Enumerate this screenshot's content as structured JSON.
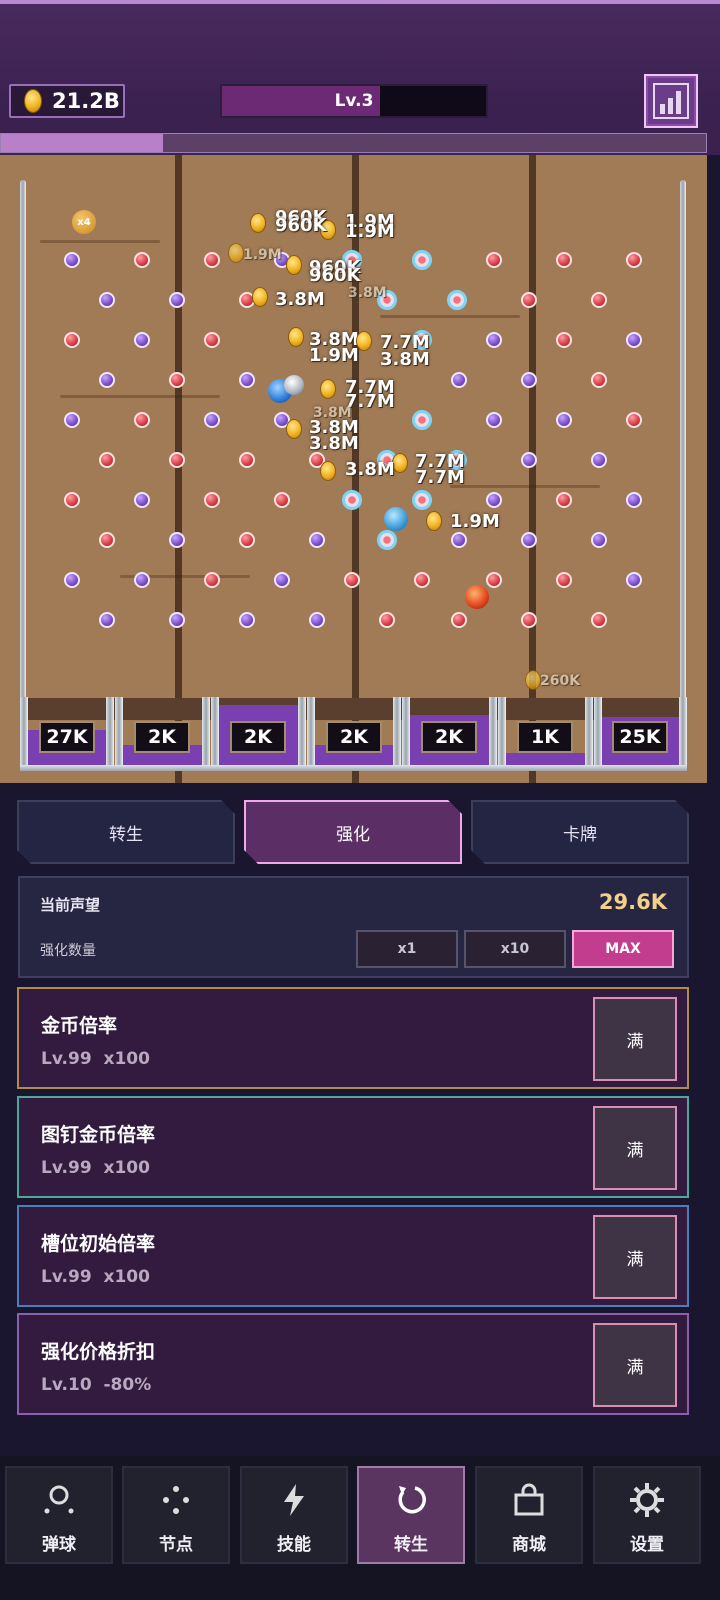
{
  "header": {
    "coin_balance": "21.2B",
    "level_label": "Lv.3",
    "level_progress": 0.6,
    "stats_icon": "bar-chart-icon",
    "stage_progress": 0.23
  },
  "board": {
    "multiplier_badge": "x4",
    "floating_values": [
      "960K",
      "1.9M",
      "960K",
      "1.9M",
      "1.9M",
      "960K",
      "960K",
      "3.8M",
      "3.8M",
      "3.8M",
      "7.7M",
      "1.9M",
      "3.8M",
      "7.7M",
      "7.7M",
      "3.8M",
      "3.8M",
      "3.8M",
      "7.7M",
      "3.8M",
      "7.7M",
      "1.9M",
      "260K"
    ],
    "slots": [
      "27K",
      "2K",
      "2K",
      "2K",
      "2K",
      "1K",
      "25K"
    ]
  },
  "tabs": [
    {
      "label": "转生",
      "active": false
    },
    {
      "label": "强化",
      "active": true
    },
    {
      "label": "卡牌",
      "active": false
    }
  ],
  "prestige": {
    "label": "当前声望",
    "value": "29.6K",
    "quantity_label": "强化数量",
    "options": [
      "x1",
      "x10",
      "MAX"
    ],
    "selected": "MAX"
  },
  "upgrades": [
    {
      "name": "金币倍率",
      "level": "Lv.99",
      "effect": "x100",
      "button": "满",
      "border": "#b08a4e"
    },
    {
      "name": "图钉金币倍率",
      "level": "Lv.99",
      "effect": "x100",
      "button": "满",
      "border": "#4ea89a"
    },
    {
      "name": "槽位初始倍率",
      "level": "Lv.99",
      "effect": "x100",
      "button": "满",
      "border": "#4c7fb8"
    },
    {
      "name": "强化价格折扣",
      "level": "Lv.10",
      "effect": "-80%",
      "button": "满",
      "border": "#8a5fae"
    }
  ],
  "nav": [
    {
      "label": "弹球",
      "icon": "ball-icon",
      "active": false
    },
    {
      "label": "节点",
      "icon": "nodes-icon",
      "active": false
    },
    {
      "label": "技能",
      "icon": "lightning-icon",
      "active": false
    },
    {
      "label": "转生",
      "icon": "rebirth-icon",
      "active": true
    },
    {
      "label": "商城",
      "icon": "shop-bag-icon",
      "active": false
    },
    {
      "label": "设置",
      "icon": "gear-icon",
      "active": false
    }
  ]
}
